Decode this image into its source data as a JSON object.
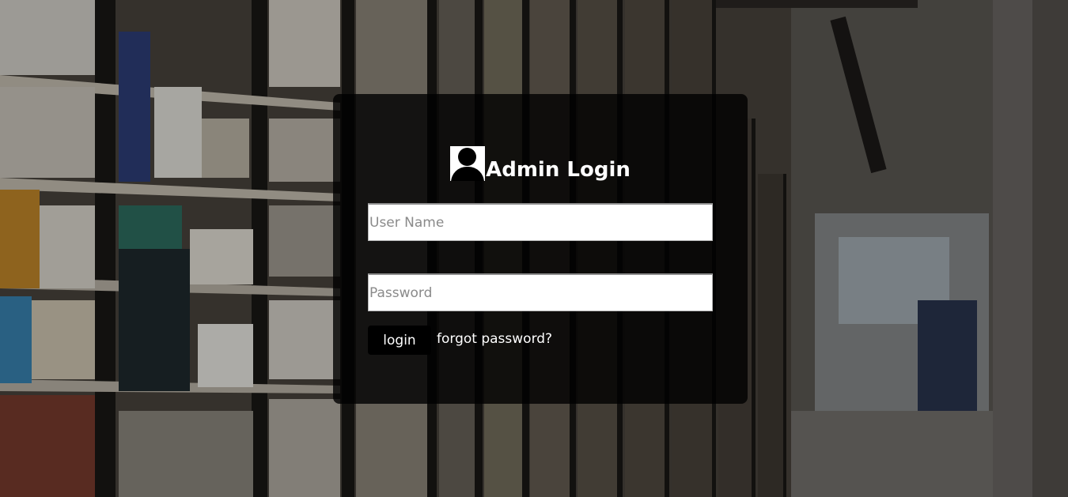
{
  "login": {
    "title": "Admin Login",
    "icon": "user-icon",
    "username_placeholder": "User Name",
    "username_value": "",
    "password_placeholder": "Password",
    "password_value": "",
    "login_label": "login",
    "forgot_label": "forgot password?"
  },
  "background": {
    "description_icon": "library-bookshelves-background"
  }
}
